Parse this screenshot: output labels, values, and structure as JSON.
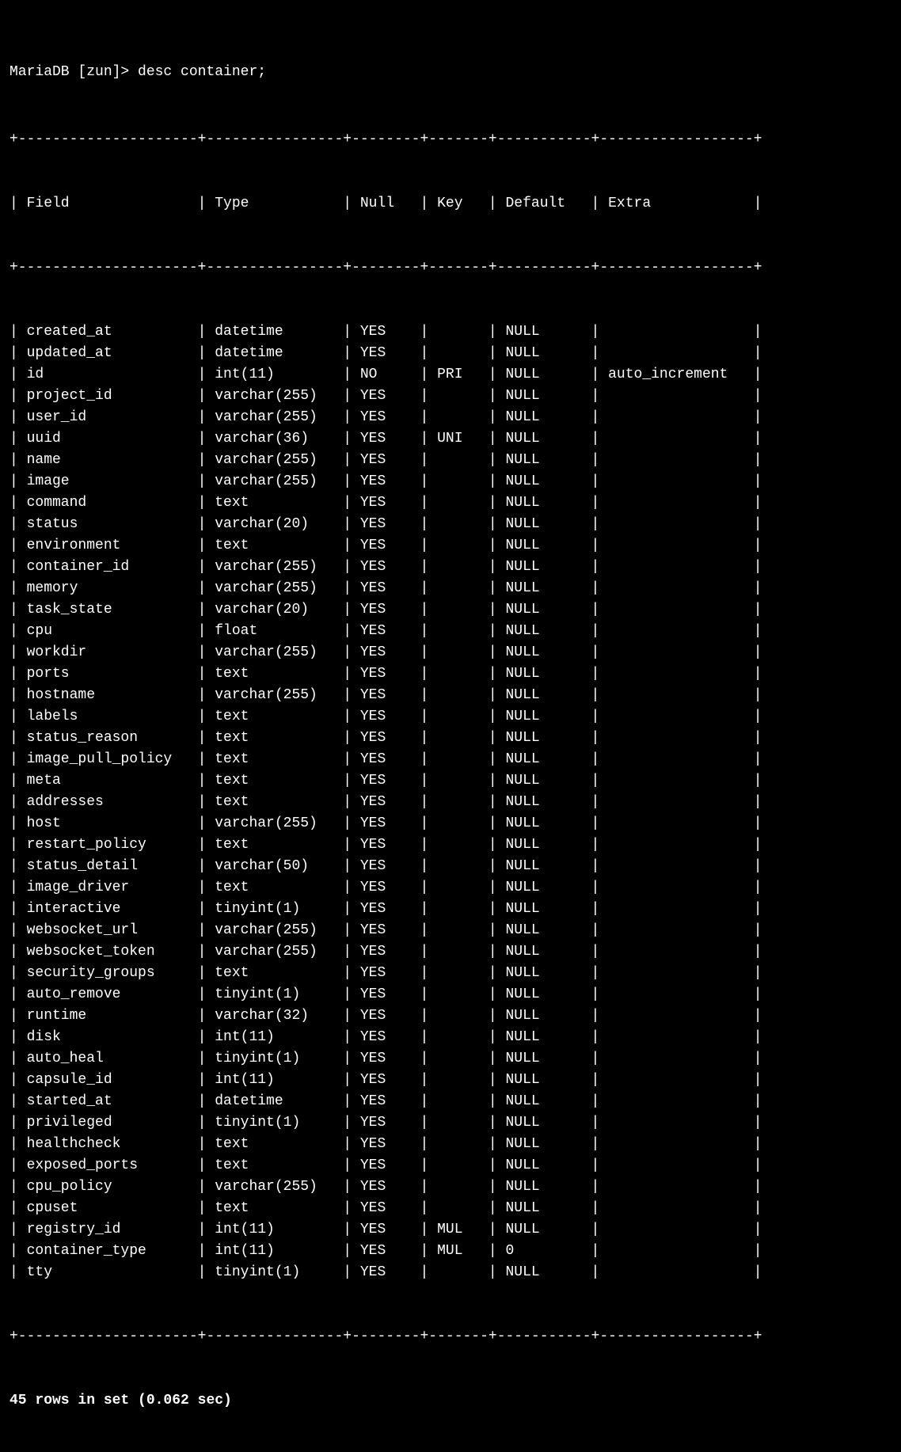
{
  "prompt": "MariaDB [zun]> desc container;",
  "headers": [
    "Field",
    "Type",
    "Null",
    "Key",
    "Default",
    "Extra"
  ],
  "widths": [
    19,
    14,
    6,
    5,
    9,
    16
  ],
  "rows": [
    {
      "Field": "created_at",
      "Type": "datetime",
      "Null": "YES",
      "Key": "",
      "Default": "NULL",
      "Extra": ""
    },
    {
      "Field": "updated_at",
      "Type": "datetime",
      "Null": "YES",
      "Key": "",
      "Default": "NULL",
      "Extra": ""
    },
    {
      "Field": "id",
      "Type": "int(11)",
      "Null": "NO",
      "Key": "PRI",
      "Default": "NULL",
      "Extra": "auto_increment"
    },
    {
      "Field": "project_id",
      "Type": "varchar(255)",
      "Null": "YES",
      "Key": "",
      "Default": "NULL",
      "Extra": ""
    },
    {
      "Field": "user_id",
      "Type": "varchar(255)",
      "Null": "YES",
      "Key": "",
      "Default": "NULL",
      "Extra": ""
    },
    {
      "Field": "uuid",
      "Type": "varchar(36)",
      "Null": "YES",
      "Key": "UNI",
      "Default": "NULL",
      "Extra": ""
    },
    {
      "Field": "name",
      "Type": "varchar(255)",
      "Null": "YES",
      "Key": "",
      "Default": "NULL",
      "Extra": ""
    },
    {
      "Field": "image",
      "Type": "varchar(255)",
      "Null": "YES",
      "Key": "",
      "Default": "NULL",
      "Extra": ""
    },
    {
      "Field": "command",
      "Type": "text",
      "Null": "YES",
      "Key": "",
      "Default": "NULL",
      "Extra": ""
    },
    {
      "Field": "status",
      "Type": "varchar(20)",
      "Null": "YES",
      "Key": "",
      "Default": "NULL",
      "Extra": ""
    },
    {
      "Field": "environment",
      "Type": "text",
      "Null": "YES",
      "Key": "",
      "Default": "NULL",
      "Extra": ""
    },
    {
      "Field": "container_id",
      "Type": "varchar(255)",
      "Null": "YES",
      "Key": "",
      "Default": "NULL",
      "Extra": ""
    },
    {
      "Field": "memory",
      "Type": "varchar(255)",
      "Null": "YES",
      "Key": "",
      "Default": "NULL",
      "Extra": ""
    },
    {
      "Field": "task_state",
      "Type": "varchar(20)",
      "Null": "YES",
      "Key": "",
      "Default": "NULL",
      "Extra": ""
    },
    {
      "Field": "cpu",
      "Type": "float",
      "Null": "YES",
      "Key": "",
      "Default": "NULL",
      "Extra": ""
    },
    {
      "Field": "workdir",
      "Type": "varchar(255)",
      "Null": "YES",
      "Key": "",
      "Default": "NULL",
      "Extra": ""
    },
    {
      "Field": "ports",
      "Type": "text",
      "Null": "YES",
      "Key": "",
      "Default": "NULL",
      "Extra": ""
    },
    {
      "Field": "hostname",
      "Type": "varchar(255)",
      "Null": "YES",
      "Key": "",
      "Default": "NULL",
      "Extra": ""
    },
    {
      "Field": "labels",
      "Type": "text",
      "Null": "YES",
      "Key": "",
      "Default": "NULL",
      "Extra": ""
    },
    {
      "Field": "status_reason",
      "Type": "text",
      "Null": "YES",
      "Key": "",
      "Default": "NULL",
      "Extra": ""
    },
    {
      "Field": "image_pull_policy",
      "Type": "text",
      "Null": "YES",
      "Key": "",
      "Default": "NULL",
      "Extra": ""
    },
    {
      "Field": "meta",
      "Type": "text",
      "Null": "YES",
      "Key": "",
      "Default": "NULL",
      "Extra": ""
    },
    {
      "Field": "addresses",
      "Type": "text",
      "Null": "YES",
      "Key": "",
      "Default": "NULL",
      "Extra": ""
    },
    {
      "Field": "host",
      "Type": "varchar(255)",
      "Null": "YES",
      "Key": "",
      "Default": "NULL",
      "Extra": ""
    },
    {
      "Field": "restart_policy",
      "Type": "text",
      "Null": "YES",
      "Key": "",
      "Default": "NULL",
      "Extra": ""
    },
    {
      "Field": "status_detail",
      "Type": "varchar(50)",
      "Null": "YES",
      "Key": "",
      "Default": "NULL",
      "Extra": ""
    },
    {
      "Field": "image_driver",
      "Type": "text",
      "Null": "YES",
      "Key": "",
      "Default": "NULL",
      "Extra": ""
    },
    {
      "Field": "interactive",
      "Type": "tinyint(1)",
      "Null": "YES",
      "Key": "",
      "Default": "NULL",
      "Extra": ""
    },
    {
      "Field": "websocket_url",
      "Type": "varchar(255)",
      "Null": "YES",
      "Key": "",
      "Default": "NULL",
      "Extra": ""
    },
    {
      "Field": "websocket_token",
      "Type": "varchar(255)",
      "Null": "YES",
      "Key": "",
      "Default": "NULL",
      "Extra": ""
    },
    {
      "Field": "security_groups",
      "Type": "text",
      "Null": "YES",
      "Key": "",
      "Default": "NULL",
      "Extra": ""
    },
    {
      "Field": "auto_remove",
      "Type": "tinyint(1)",
      "Null": "YES",
      "Key": "",
      "Default": "NULL",
      "Extra": ""
    },
    {
      "Field": "runtime",
      "Type": "varchar(32)",
      "Null": "YES",
      "Key": "",
      "Default": "NULL",
      "Extra": ""
    },
    {
      "Field": "disk",
      "Type": "int(11)",
      "Null": "YES",
      "Key": "",
      "Default": "NULL",
      "Extra": ""
    },
    {
      "Field": "auto_heal",
      "Type": "tinyint(1)",
      "Null": "YES",
      "Key": "",
      "Default": "NULL",
      "Extra": ""
    },
    {
      "Field": "capsule_id",
      "Type": "int(11)",
      "Null": "YES",
      "Key": "",
      "Default": "NULL",
      "Extra": ""
    },
    {
      "Field": "started_at",
      "Type": "datetime",
      "Null": "YES",
      "Key": "",
      "Default": "NULL",
      "Extra": ""
    },
    {
      "Field": "privileged",
      "Type": "tinyint(1)",
      "Null": "YES",
      "Key": "",
      "Default": "NULL",
      "Extra": ""
    },
    {
      "Field": "healthcheck",
      "Type": "text",
      "Null": "YES",
      "Key": "",
      "Default": "NULL",
      "Extra": ""
    },
    {
      "Field": "exposed_ports",
      "Type": "text",
      "Null": "YES",
      "Key": "",
      "Default": "NULL",
      "Extra": ""
    },
    {
      "Field": "cpu_policy",
      "Type": "varchar(255)",
      "Null": "YES",
      "Key": "",
      "Default": "NULL",
      "Extra": ""
    },
    {
      "Field": "cpuset",
      "Type": "text",
      "Null": "YES",
      "Key": "",
      "Default": "NULL",
      "Extra": ""
    },
    {
      "Field": "registry_id",
      "Type": "int(11)",
      "Null": "YES",
      "Key": "MUL",
      "Default": "NULL",
      "Extra": ""
    },
    {
      "Field": "container_type",
      "Type": "int(11)",
      "Null": "YES",
      "Key": "MUL",
      "Default": "0",
      "Extra": ""
    },
    {
      "Field": "tty",
      "Type": "tinyint(1)",
      "Null": "YES",
      "Key": "",
      "Default": "NULL",
      "Extra": ""
    }
  ],
  "footer": "45 rows in set (0.062 sec)"
}
